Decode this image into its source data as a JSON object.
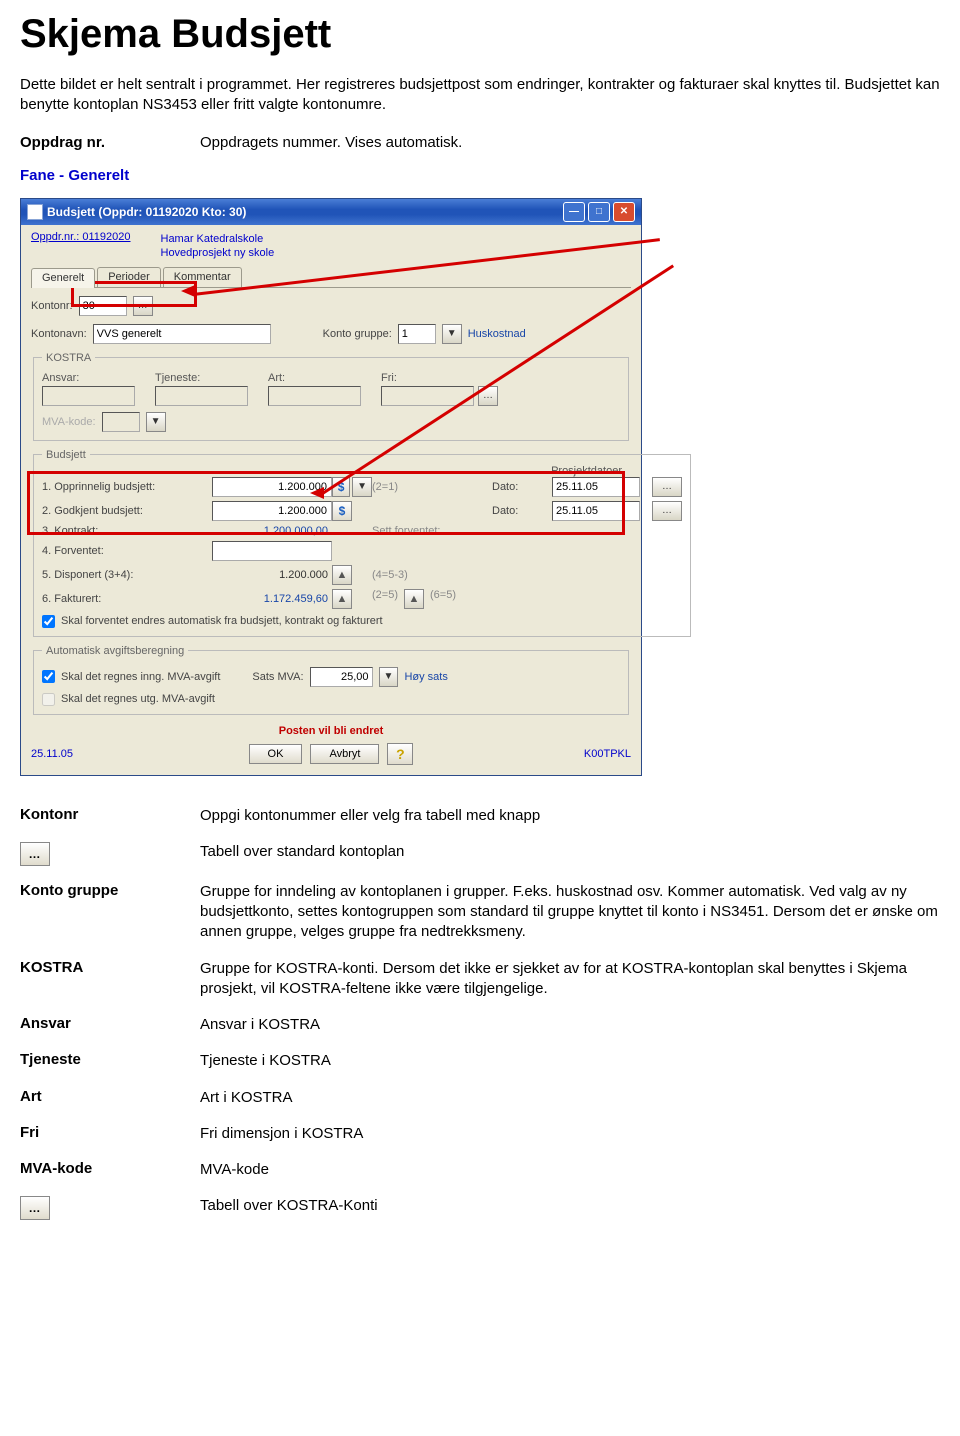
{
  "doc": {
    "title": "Skjema Budsjett",
    "intro": "Dette bildet er helt sentralt i programmet. Her registreres budsjettpost som endringer, kontrakter og fakturaer skal knyttes til. Budsjettet kan benytte kontoplan NS3453 eller fritt valgte kontonumre.",
    "oppdrag_label": "Oppdrag nr.",
    "oppdrag_desc": "Oppdragets nummer. Vises automatisk.",
    "fane_label": "Fane - Generelt"
  },
  "window": {
    "title": "Budsjett  (Oppdr: 01192020 Kto: 30)",
    "header_link": "Oppdr.nr.: 01192020",
    "header_name": "Hamar Katedralskole",
    "header_sub": "Hovedprosjekt ny skole",
    "tabs": {
      "t1": "Generelt",
      "t2": "Perioder",
      "t3": "Kommentar"
    },
    "kontonr_label": "Kontonr:",
    "kontonr_val": "30",
    "kontonavn_label": "Kontonavn:",
    "kontonavn_val": "VVS generelt",
    "kontogruppe_label": "Konto gruppe:",
    "kontogruppe_val": "1",
    "kontogruppe_name": "Huskostnad",
    "kostra_legend": "KOSTRA",
    "ansvar_l": "Ansvar:",
    "tjeneste_l": "Tjeneste:",
    "art_l": "Art:",
    "fri_l": "Fri:",
    "mva_l": "MVA-kode:",
    "budsjett_legend": "Budsjett",
    "prosjektdatoer": "Prosjektdatoer",
    "rows": {
      "r1": "1. Opprinnelig budsjett:",
      "r2": "2. Godkjent budsjett:",
      "r3": "3. Kontrakt:",
      "r4": "4. Forventet:",
      "r5": "5. Disponert (3+4):",
      "r6": "6. Fakturert:"
    },
    "vals": {
      "v1": "1.200.000",
      "v2": "1.200.000",
      "v3": "1.200.000,00",
      "v4": "",
      "v5": "1.200.000",
      "v6": "1.172.459,60"
    },
    "badge_21": "(2=1)",
    "hint_forventet": "Sett forventet:",
    "badge_453": "(4=5-3)",
    "badge_25": "(2=5)",
    "badge_65": "(6=5)",
    "date_l": "Dato:",
    "date_val": "25.11.05",
    "chk1": "Skal forventet endres automatisk fra budsjett, kontrakt og fakturert",
    "avgift_legend": "Automatisk avgiftsberegning",
    "chk2": "Skal det regnes inng. MVA-avgift",
    "chk3": "Skal det regnes utg. MVA-avgift",
    "sats_l": "Sats MVA:",
    "sats_v": "25,00",
    "sats_name": "Høy sats",
    "status": "Posten vil bli endret",
    "footer_date": "25.11.05",
    "footer_user": "K00TPKL",
    "ok": "OK",
    "avbryt": "Avbryt"
  },
  "defs": {
    "kontonr_l": "Kontonr",
    "kontonr_d": "Oppgi kontonummer eller velg fra tabell med knapp",
    "tabell_kontoplan": "Tabell over standard kontoplan",
    "kontogruppe_l": "Konto gruppe",
    "kontogruppe_d": "Gruppe for inndeling av kontoplanen i grupper. F.eks. huskostnad osv. Kommer automatisk. Ved valg av ny budsjettkonto, settes kontogruppen som standard til gruppe knyttet til konto i NS3451. Dersom det er ønske om annen gruppe, velges gruppe fra nedtrekksmeny.",
    "kostra_l": "KOSTRA",
    "kostra_d": "Gruppe for KOSTRA-konti. Dersom det ikke er sjekket av for at KOSTRA-kontoplan skal benyttes i Skjema prosjekt, vil KOSTRA-feltene ikke være tilgjengelige.",
    "ansvar_l": "Ansvar",
    "ansvar_d": "Ansvar i KOSTRA",
    "tjeneste_l": "Tjeneste",
    "tjeneste_d": "Tjeneste i KOSTRA",
    "art_l": "Art",
    "art_d": "Art i KOSTRA",
    "fri_l": "Fri",
    "fri_d": "Fri dimensjon i KOSTRA",
    "mva_l": "MVA-kode",
    "mva_d": "MVA-kode",
    "tabell_kostra": "Tabell over KOSTRA-Konti"
  }
}
